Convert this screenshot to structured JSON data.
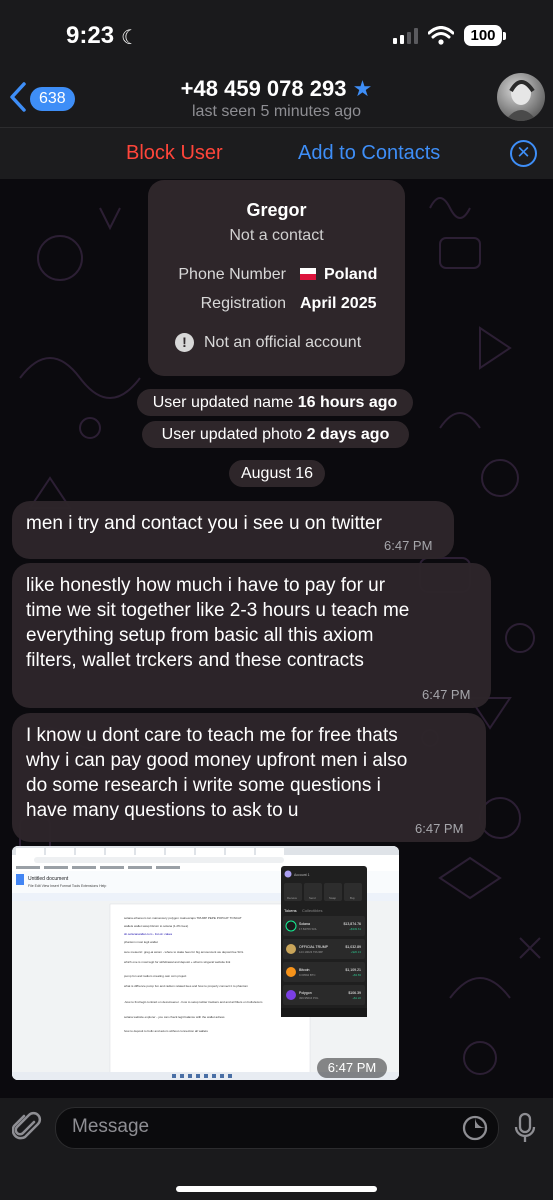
{
  "status": {
    "time": "9:23",
    "battery": "100"
  },
  "header": {
    "back_count": "638",
    "title": "+48 459 078 293",
    "subtitle": "last seen 5 minutes ago"
  },
  "actions": {
    "block": "Block User",
    "add": "Add to Contacts"
  },
  "info_card": {
    "name": "Gregor",
    "status": "Not a contact",
    "phone_label": "Phone Number",
    "phone_value": "Poland",
    "registration_label": "Registration",
    "registration_value": "April 2025",
    "official_note": "Not an official account"
  },
  "service": {
    "name_prefix": "User updated name ",
    "name_time": "16 hours ago",
    "photo_prefix": "User updated photo ",
    "photo_time": "2 days ago",
    "date": "August 16"
  },
  "messages": [
    {
      "lines": [
        "men i try and contact you i see u on twitter"
      ],
      "time": "6:47 PM"
    },
    {
      "lines": [
        "like honestly how much i have to pay for ur",
        "time we sit together like 2-3 hours u teach me",
        "everything setup from basic all this axiom",
        "filters, wallet trckers and these contracts"
      ],
      "time": "6:47 PM"
    },
    {
      "lines": [
        "I know u dont care to teach me for free thats",
        "why i can pay good money upfront men i also",
        "do some research i write some questions i",
        "have many questions to ask to u"
      ],
      "time": "6:47 PM"
    }
  ],
  "screenshot": {
    "time": "6:47 PM",
    "doc_title": "Untitled document",
    "menu": "File  Edit  View  Insert  Format  Tools  Extensions  Help",
    "lines": [
      "solana ethereum ton mainexcery polygon mainexcaps        TRUMP PEPE POPCAT TONCAT",
      "wallets wallet swap bitcoin to solana (1.2% fees)",
      "sb.solscanwallet.com - list ok: cakes",
      "phantom most legit wallet",
      "sure meteoric: greg-ai axiom - where to stake fees for big announcent we deposit fee SOL",
      "which one is most legit for withdrawal and deposit + what is singeral website link",
      "pump fun and radium creating own coin project",
      "what is diffrence pump fun and radium related fees and how to properly connect it to phantom",
      "-how to find legit contract on dexscreener - how to setup twitter trackers and and ail filters on bullx/axiom",
      "solana website explorer - you can check legit balance with the wallet adress",
      "how to deposit to bullx and axiom without connection all wallets"
    ],
    "wallet": {
      "account": "Account 1",
      "actions": [
        "Receive",
        "Send",
        "Swap",
        "Buy"
      ],
      "tabs": [
        "Tokens",
        "Collectibles"
      ],
      "tokens": [
        {
          "name": "Solana",
          "sub": "17.84709 SOL",
          "value": "$13,874.76",
          "change": "+$349.61",
          "color": "#1a1a1a"
        },
        {
          "name": "OFFICIAL TRUMP",
          "sub": "123.19023 TRUMP",
          "value": "$1,032.89",
          "change": "+$20.13",
          "color": "#c9a55a"
        },
        {
          "name": "Bitcoin",
          "sub": "0.00594 BTC",
          "value": "$1,109.21",
          "change": "+$3.83",
          "color": "#f7931a"
        },
        {
          "name": "Polygon",
          "sub": "499.95616 POL",
          "value": "$106.39",
          "change": "+$1.22",
          "color": "#7b3fe4"
        }
      ]
    }
  },
  "input": {
    "placeholder": "Message"
  }
}
